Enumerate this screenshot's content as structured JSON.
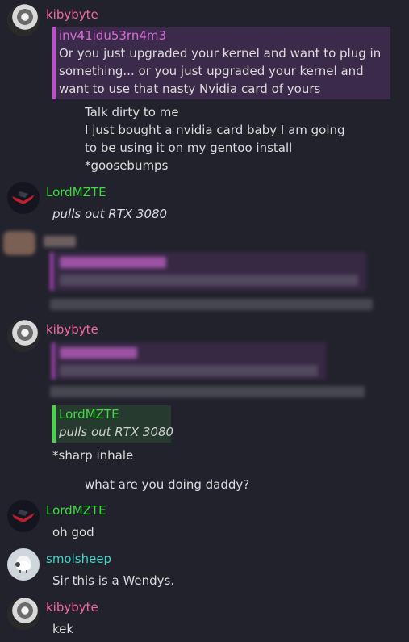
{
  "messages": [
    {
      "author": "kibybyte",
      "reply": {
        "author": "inv41idu53rn4m3",
        "lines": [
          "Or you just upgraded your kernel and want to plug in",
          "something... or you just upgraded your kernel and",
          "want to use that nasty Nvidia card of yours"
        ]
      },
      "lines": [
        "Talk dirty to me",
        "I just bought a nvidia card baby I am going",
        "to be using it on my gentoo install",
        "*goosebumps"
      ]
    },
    {
      "author": "LordMZTE",
      "lines": [
        "pulls out RTX 3080"
      ]
    },
    {
      "author": "kibybyte",
      "reply": {
        "author": "LordMZTE",
        "lines": [
          "pulls out RTX 3080"
        ]
      },
      "lines": [
        "*sharp inhale",
        "what are you doing daddy?"
      ]
    },
    {
      "author": "LordMZTE",
      "lines": [
        "oh god"
      ]
    },
    {
      "author": "smolsheep",
      "lines": [
        "Sir this is a Wendys."
      ]
    },
    {
      "author": "kibybyte",
      "lines": [
        "kek"
      ]
    }
  ],
  "colors": {
    "background": "#22222d",
    "kibybyte": "#f06a9a",
    "LordMZTE": "#3ddc3d",
    "smolsheep": "#3ad6c8",
    "inv41idu53rn4m3": "#d86ad8"
  }
}
